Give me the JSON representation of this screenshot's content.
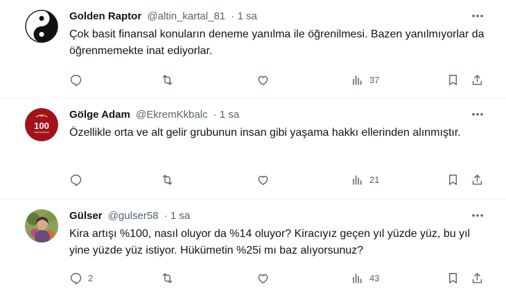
{
  "tweets": [
    {
      "display_name": "Golden Raptor",
      "handle": "@altin_kartal_81",
      "time": "· 1 sa",
      "text": "Çok basit finansal konuların deneme yanılma ile öğrenilmesi. Bazen yanılmıyorlar da öğrenmemekte inat ediyorlar.",
      "replies": "",
      "retweets": "",
      "likes": "",
      "views": "37",
      "avatar_icon": "yin-yang-icon"
    },
    {
      "display_name": "Gölge Adam",
      "handle": "@EkremKkbalc",
      "time": "· 1 sa",
      "text": "Özellikle orta ve alt gelir grubunun insan gibi yaşama hakkı ellerinden alınmıştır.",
      "replies": "",
      "retweets": "",
      "likes": "",
      "views": "21",
      "avatar_icon": "centenary-emblem-icon",
      "avatar_label": "100"
    },
    {
      "display_name": "Gülser",
      "handle": "@gulser58",
      "time": "· 1 sa",
      "text": "Kira artışı %100, nasıl oluyor da %14 oluyor? Kiracıyız geçen yıl yüzde yüz, bu yıl yine yüzde yüz istiyor. Hükümetin %25i mı baz alıyorsunuz?",
      "replies": "2",
      "retweets": "",
      "likes": "",
      "views": "43",
      "avatar_icon": "profile-photo-icon"
    }
  ],
  "colors": {
    "text": "#0f1419",
    "secondary": "#536471",
    "divider": "#eff3f4",
    "avatar_red": "#a3121a"
  }
}
